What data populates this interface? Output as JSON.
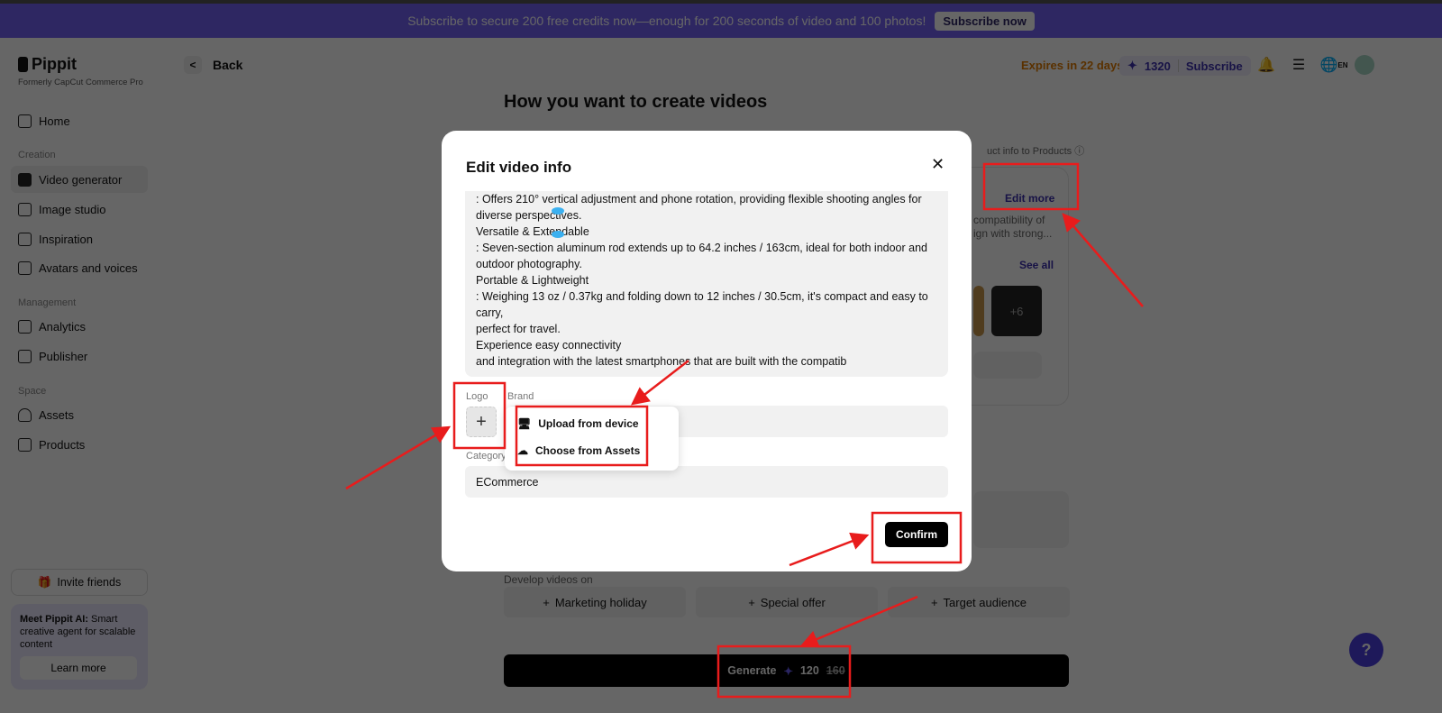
{
  "banner": {
    "text": "Subscribe to secure 200 free credits now—enough for 200 seconds of video and 100 photos!",
    "button": "Subscribe now"
  },
  "brand": {
    "name": "Pippit",
    "subtitle": "Formerly CapCut Commerce Pro"
  },
  "sidebar": {
    "home": "Home",
    "sections": [
      {
        "title": "Creation",
        "items": [
          "Video generator",
          "Image studio",
          "Inspiration",
          "Avatars and voices"
        ]
      },
      {
        "title": "Management",
        "items": [
          "Analytics",
          "Publisher"
        ]
      },
      {
        "title": "Space",
        "items": [
          "Assets",
          "Products"
        ]
      }
    ],
    "invite": "Invite friends",
    "promo_text": "Meet Pippit AI:",
    "promo_text2": "Smart creative agent for scalable content",
    "learn_more": "Learn more"
  },
  "header": {
    "back": "Back",
    "expires": "Expires in 22 days",
    "credits": "1320",
    "subscribe": "Subscribe",
    "lang": "EN"
  },
  "main": {
    "title": "How you want to create videos",
    "product_info_note": "uct info to Products",
    "edit_more": "Edit more",
    "desc1": "compatibility of",
    "desc2": "ign with strong...",
    "see_all": "See all",
    "more_count": "+6",
    "develop_label": "Develop videos on",
    "develop_options": [
      "Marketing holiday",
      "Special offer",
      "Target audience"
    ],
    "generate": "Generate",
    "generate_cost": "120",
    "generate_old_cost": "160"
  },
  "modal": {
    "title": "Edit video info",
    "description_lines": [
      ": Offers 210° vertical adjustment and phone rotation, providing flexible shooting angles for",
      "diverse perspectives.",
      "Versatile & Extendable",
      ": Seven-section aluminum rod extends up to 64.2 inches / 163cm, ideal for both indoor and",
      "outdoor photography.",
      "Portable & Lightweight",
      ": Weighing 13 oz / 0.37kg and folding down to 12 inches / 30.5cm, it's compact and easy to carry,",
      "perfect for travel.",
      "Experience easy connectivity",
      "and integration with the latest smartphones that are built with the compatib"
    ],
    "logo_label": "Logo",
    "brand_label": "Brand",
    "category_label": "Category",
    "category_value": "ECommerce",
    "upload_menu": [
      "Upload from device",
      "Choose from Assets"
    ],
    "confirm": "Confirm"
  },
  "colors": {
    "accent": "#3b2fb0",
    "banner": "#7462f5",
    "annotation": "#e81c1c"
  }
}
